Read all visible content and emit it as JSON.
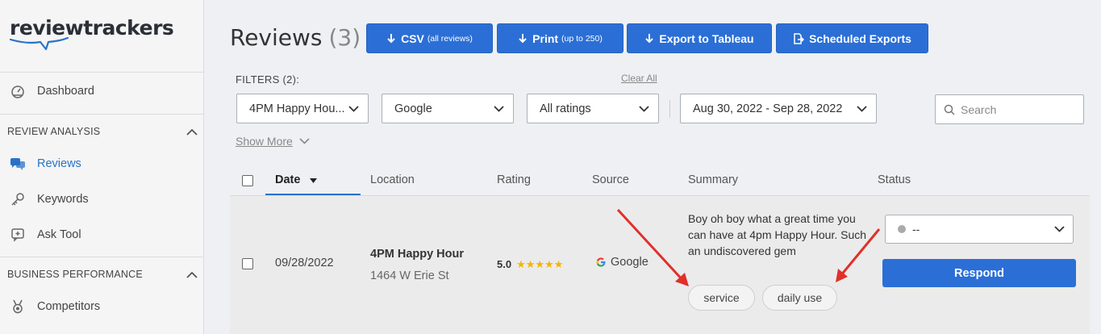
{
  "brand": {
    "name": "reviewtrackers"
  },
  "sidebar": {
    "items": [
      {
        "label": "Dashboard",
        "icon": "dashboard-icon"
      },
      {
        "label": "Reviews",
        "icon": "chat-bubbles-icon",
        "active": true
      },
      {
        "label": "Keywords",
        "icon": "key-icon"
      },
      {
        "label": "Ask Tool",
        "icon": "message-plus-icon"
      },
      {
        "label": "Competitors",
        "icon": "medal-icon"
      }
    ],
    "sections": [
      {
        "label": "REVIEW ANALYSIS"
      },
      {
        "label": "BUSINESS PERFORMANCE"
      }
    ]
  },
  "header": {
    "title": "Reviews",
    "count": "(3)",
    "buttons": [
      {
        "label": "CSV",
        "note": "(all reviews)"
      },
      {
        "label": "Print",
        "note": "(up to 250)"
      },
      {
        "label": "Export to Tableau",
        "note": ""
      },
      {
        "label": "Scheduled Exports",
        "note": ""
      }
    ]
  },
  "filters": {
    "label": "FILTERS (2):",
    "clear_all": "Clear All",
    "location": "4PM Happy Hou...",
    "source": "Google",
    "rating": "All ratings",
    "date_range": "Aug 30, 2022 - Sep 28, 2022",
    "search_placeholder": "Search",
    "show_more": "Show More"
  },
  "table": {
    "columns": [
      "Date",
      "Location",
      "Rating",
      "Source",
      "Summary",
      "Status"
    ],
    "rows": [
      {
        "date": "09/28/2022",
        "location_name": "4PM Happy Hour",
        "location_address": "1464 W Erie St",
        "rating": "5.0",
        "stars": 5,
        "source": "Google",
        "summary": "Boy oh boy what a great time you can have at 4pm Happy Hour. Such an undiscovered gem",
        "tags": [
          "service",
          "daily use"
        ],
        "status": "--",
        "respond_label": "Respond"
      }
    ]
  },
  "colors": {
    "accent": "#2b6fd6",
    "annotation_arrow": "#e0302a",
    "star": "#f5b400"
  }
}
